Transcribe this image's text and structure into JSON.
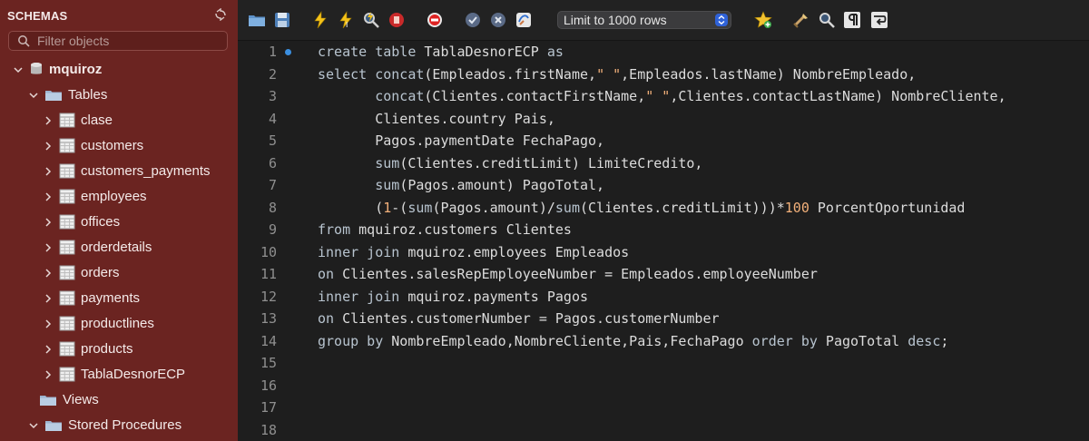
{
  "sidebar": {
    "title": "SCHEMAS",
    "refresh_icon": "refresh-icon",
    "filter_placeholder": "Filter objects",
    "schema": "mquiroz",
    "tables_label": "Tables",
    "tables": [
      "clase",
      "customers",
      "customers_payments",
      "employees",
      "offices",
      "orderdetails",
      "orders",
      "payments",
      "productlines",
      "products",
      "TablaDesnorECP"
    ],
    "views_label": "Views",
    "procedures_label": "Stored Procedures"
  },
  "toolbar": {
    "icons": [
      "open-folder-icon",
      "save-icon",
      "execute-icon",
      "execute-statement-icon",
      "explain-icon",
      "stop-icon",
      "toggle-error-icon",
      "commit-icon",
      "rollback-icon",
      "autocommit-icon",
      "beautify-icon",
      "find-icon",
      "invisible-chars-icon",
      "word-wrap-icon",
      "add-snippet-icon"
    ],
    "limit_label": "Limit to 1000 rows"
  },
  "editor": {
    "line_numbers": [
      "1",
      "2",
      "3",
      "4",
      "5",
      "6",
      "7",
      "8",
      "9",
      "10",
      "11",
      "12",
      "13",
      "14",
      "15",
      "16",
      "17",
      "18"
    ],
    "lines": [
      [
        {
          "t": "kw",
          "v": "create table"
        },
        {
          "t": "tx",
          "v": " TablaDesnorECP "
        },
        {
          "t": "kw",
          "v": "as"
        }
      ],
      [
        {
          "t": "kw",
          "v": "select"
        },
        {
          "t": "tx",
          "v": " "
        },
        {
          "t": "kw",
          "v": "concat"
        },
        {
          "t": "tx",
          "v": "(Empleados.firstName,"
        },
        {
          "t": "str",
          "v": "\" \""
        },
        {
          "t": "tx",
          "v": ",Empleados.lastName) NombreEmpleado,"
        }
      ],
      [
        {
          "t": "tx",
          "v": "       "
        },
        {
          "t": "kw",
          "v": "concat"
        },
        {
          "t": "tx",
          "v": "(Clientes.contactFirstName,"
        },
        {
          "t": "str",
          "v": "\" \""
        },
        {
          "t": "tx",
          "v": ",Clientes.contactLastName) NombreCliente,"
        }
      ],
      [
        {
          "t": "tx",
          "v": "       Clientes.country Pais,"
        }
      ],
      [
        {
          "t": "tx",
          "v": "       Pagos.paymentDate FechaPago,"
        }
      ],
      [
        {
          "t": "tx",
          "v": "       "
        },
        {
          "t": "kw",
          "v": "sum"
        },
        {
          "t": "tx",
          "v": "(Clientes.creditLimit) LimiteCredito,"
        }
      ],
      [
        {
          "t": "tx",
          "v": "       "
        },
        {
          "t": "kw",
          "v": "sum"
        },
        {
          "t": "tx",
          "v": "(Pagos.amount) PagoTotal,"
        }
      ],
      [
        {
          "t": "tx",
          "v": "       ("
        },
        {
          "t": "num",
          "v": "1"
        },
        {
          "t": "tx",
          "v": "-("
        },
        {
          "t": "kw",
          "v": "sum"
        },
        {
          "t": "tx",
          "v": "(Pagos.amount)/"
        },
        {
          "t": "kw",
          "v": "sum"
        },
        {
          "t": "tx",
          "v": "(Clientes.creditLimit)))*"
        },
        {
          "t": "num",
          "v": "100"
        },
        {
          "t": "tx",
          "v": " PorcentOportunidad"
        }
      ],
      [
        {
          "t": "kw",
          "v": "from"
        },
        {
          "t": "tx",
          "v": " mquiroz.customers Clientes"
        }
      ],
      [
        {
          "t": "kw",
          "v": "inner join"
        },
        {
          "t": "tx",
          "v": " mquiroz.employees Empleados"
        }
      ],
      [
        {
          "t": "kw",
          "v": "on"
        },
        {
          "t": "tx",
          "v": " Clientes.salesRepEmployeeNumber = Empleados.employeeNumber"
        }
      ],
      [
        {
          "t": "kw",
          "v": "inner join"
        },
        {
          "t": "tx",
          "v": " mquiroz.payments Pagos"
        }
      ],
      [
        {
          "t": "kw",
          "v": "on"
        },
        {
          "t": "tx",
          "v": " Clientes.customerNumber = Pagos.customerNumber"
        }
      ],
      [
        {
          "t": "kw",
          "v": "group by"
        },
        {
          "t": "tx",
          "v": " NombreEmpleado,NombreCliente,Pais,FechaPago "
        },
        {
          "t": "kw",
          "v": "order by"
        },
        {
          "t": "tx",
          "v": " PagoTotal "
        },
        {
          "t": "kw",
          "v": "desc"
        },
        {
          "t": "tx",
          "v": ";"
        }
      ],
      [],
      [],
      [],
      []
    ]
  },
  "colors": {
    "sidebar_bg": "#6b2421",
    "editor_bg": "#1e1e1e",
    "keyword": "#b8c4cf",
    "string": "#f2b07a",
    "active_line_marker": "#3b8fe0"
  }
}
